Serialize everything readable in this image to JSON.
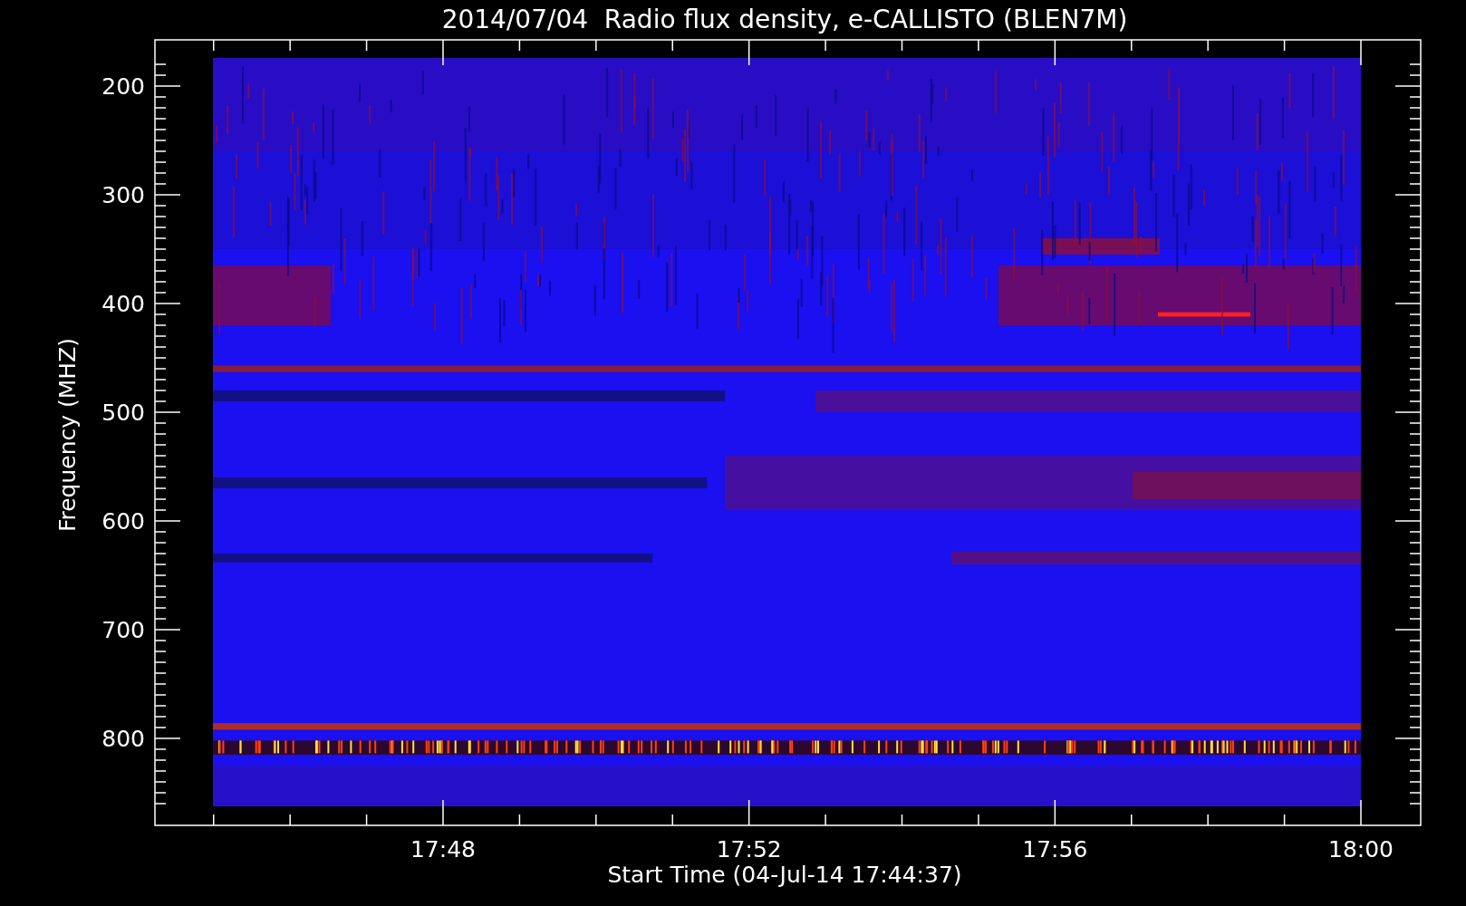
{
  "title": "2014/07/04  Radio flux density, e-CALLISTO (BLEN7M)",
  "y_axis": {
    "label": "Frequency (MHZ)",
    "ticks": [
      "200",
      "300",
      "400",
      "500",
      "600",
      "700",
      "800"
    ]
  },
  "x_axis": {
    "label": "Start Time (04-Jul-14 17:44:37)",
    "ticks": [
      "17:48",
      "17:52",
      "17:56",
      "18:00"
    ]
  }
}
